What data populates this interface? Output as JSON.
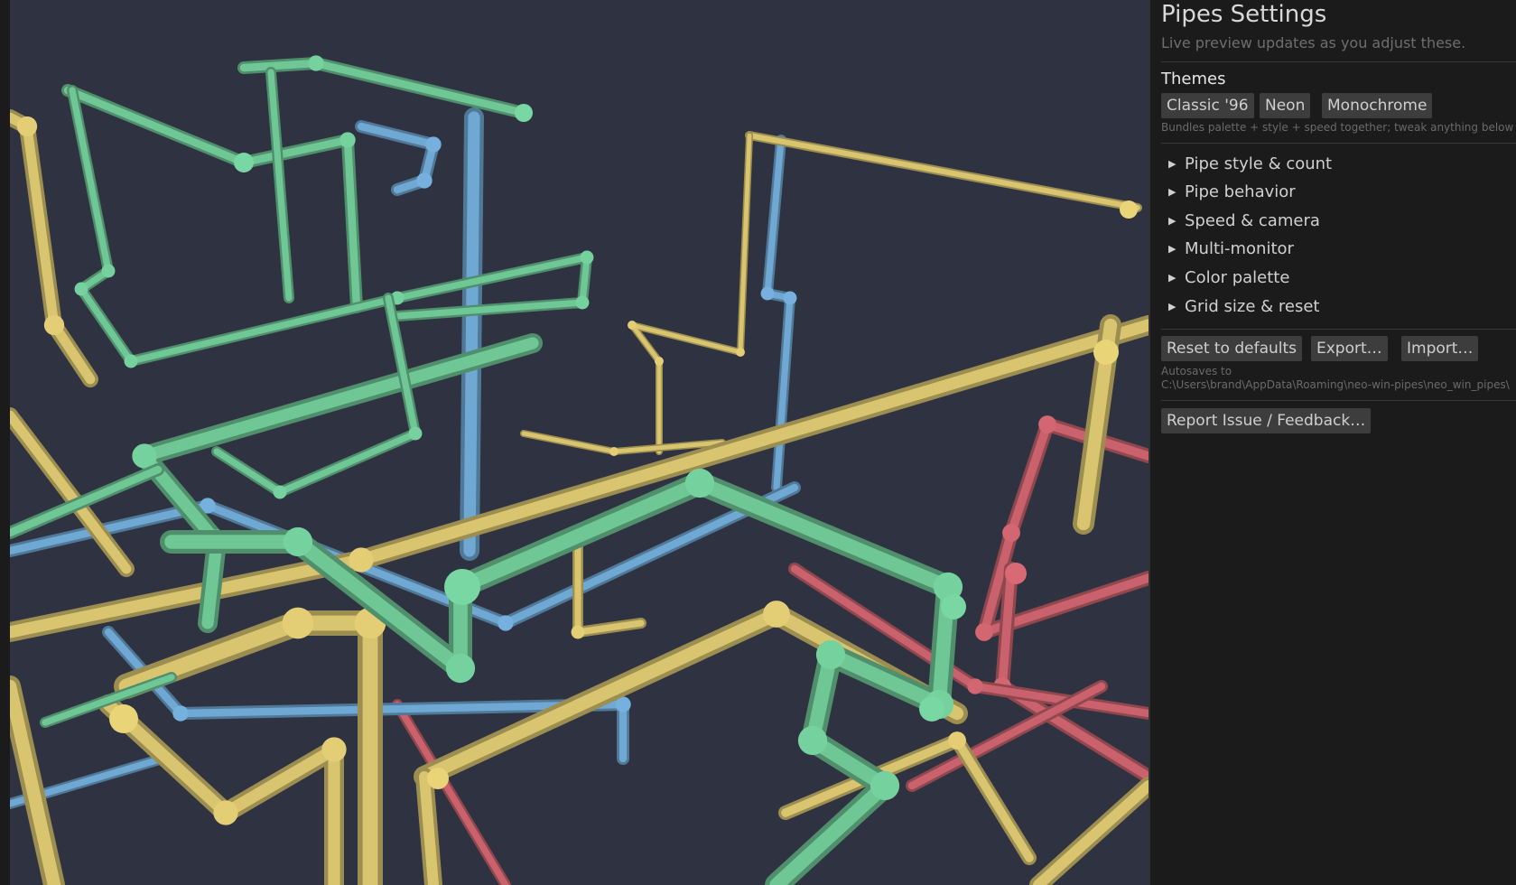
{
  "panel": {
    "title": "Pipes Settings",
    "subtitle": "Live preview updates as you adjust these.",
    "themes": {
      "heading": "Themes",
      "buttons": [
        "Classic '96",
        "Neon",
        "Monochrome"
      ],
      "hint": "Bundles palette + style + speed together; tweak anything below aft"
    },
    "sections": [
      "Pipe style & count",
      "Pipe behavior",
      "Speed & camera",
      "Multi-monitor",
      "Color palette",
      "Grid size & reset"
    ],
    "actions": {
      "reset": "Reset to defaults",
      "export": "Export…",
      "import": "Import…"
    },
    "autosave_label": "Autosaves to",
    "autosave_path": "C:\\Users\\brand\\AppData\\Roaming\\neo-win-pipes\\neo_win_pipes\\",
    "report": "Report Issue / Feedback…"
  },
  "viewport": {
    "background": "#2f3341",
    "pipe_colors": {
      "yellow": "#d9c46f",
      "green": "#6fc796",
      "blue": "#6fa8d3",
      "red": "#c9626c"
    }
  }
}
